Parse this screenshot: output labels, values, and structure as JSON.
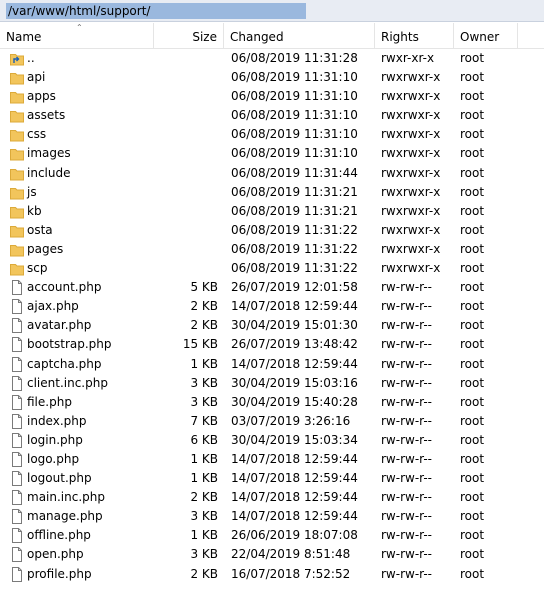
{
  "path": "/var/www/html/support/",
  "columns": {
    "name": "Name",
    "size": "Size",
    "changed": "Changed",
    "rights": "Rights",
    "owner": "Owner"
  },
  "colors": {
    "path_highlight": "#9ab8de",
    "folder": "#f2c55c",
    "folder_dark": "#dcaa3a",
    "file_border": "#7a7a7a"
  },
  "rows": [
    {
      "type": "parent",
      "name": "..",
      "size": "",
      "changed": "06/08/2019 11:31:28",
      "rights": "rwxr-xr-x",
      "owner": "root"
    },
    {
      "type": "folder",
      "name": "api",
      "size": "",
      "changed": "06/08/2019 11:31:10",
      "rights": "rwxrwxr-x",
      "owner": "root"
    },
    {
      "type": "folder",
      "name": "apps",
      "size": "",
      "changed": "06/08/2019 11:31:10",
      "rights": "rwxrwxr-x",
      "owner": "root"
    },
    {
      "type": "folder",
      "name": "assets",
      "size": "",
      "changed": "06/08/2019 11:31:10",
      "rights": "rwxrwxr-x",
      "owner": "root"
    },
    {
      "type": "folder",
      "name": "css",
      "size": "",
      "changed": "06/08/2019 11:31:10",
      "rights": "rwxrwxr-x",
      "owner": "root"
    },
    {
      "type": "folder",
      "name": "images",
      "size": "",
      "changed": "06/08/2019 11:31:10",
      "rights": "rwxrwxr-x",
      "owner": "root"
    },
    {
      "type": "folder",
      "name": "include",
      "size": "",
      "changed": "06/08/2019 11:31:44",
      "rights": "rwxrwxr-x",
      "owner": "root"
    },
    {
      "type": "folder",
      "name": "js",
      "size": "",
      "changed": "06/08/2019 11:31:21",
      "rights": "rwxrwxr-x",
      "owner": "root"
    },
    {
      "type": "folder",
      "name": "kb",
      "size": "",
      "changed": "06/08/2019 11:31:21",
      "rights": "rwxrwxr-x",
      "owner": "root"
    },
    {
      "type": "folder",
      "name": "osta",
      "size": "",
      "changed": "06/08/2019 11:31:22",
      "rights": "rwxrwxr-x",
      "owner": "root"
    },
    {
      "type": "folder",
      "name": "pages",
      "size": "",
      "changed": "06/08/2019 11:31:22",
      "rights": "rwxrwxr-x",
      "owner": "root"
    },
    {
      "type": "folder",
      "name": "scp",
      "size": "",
      "changed": "06/08/2019 11:31:22",
      "rights": "rwxrwxr-x",
      "owner": "root"
    },
    {
      "type": "file",
      "name": "account.php",
      "size": "5 KB",
      "changed": "26/07/2019 12:01:58",
      "rights": "rw-rw-r--",
      "owner": "root"
    },
    {
      "type": "file",
      "name": "ajax.php",
      "size": "2 KB",
      "changed": "14/07/2018 12:59:44",
      "rights": "rw-rw-r--",
      "owner": "root"
    },
    {
      "type": "file",
      "name": "avatar.php",
      "size": "2 KB",
      "changed": "30/04/2019 15:01:30",
      "rights": "rw-rw-r--",
      "owner": "root"
    },
    {
      "type": "file",
      "name": "bootstrap.php",
      "size": "15 KB",
      "changed": "26/07/2019 13:48:42",
      "rights": "rw-rw-r--",
      "owner": "root"
    },
    {
      "type": "file",
      "name": "captcha.php",
      "size": "1 KB",
      "changed": "14/07/2018 12:59:44",
      "rights": "rw-rw-r--",
      "owner": "root"
    },
    {
      "type": "file",
      "name": "client.inc.php",
      "size": "3 KB",
      "changed": "30/04/2019 15:03:16",
      "rights": "rw-rw-r--",
      "owner": "root"
    },
    {
      "type": "file",
      "name": "file.php",
      "size": "3 KB",
      "changed": "30/04/2019 15:40:28",
      "rights": "rw-rw-r--",
      "owner": "root"
    },
    {
      "type": "file",
      "name": "index.php",
      "size": "7 KB",
      "changed": "03/07/2019 3:26:16",
      "rights": "rw-rw-r--",
      "owner": "root"
    },
    {
      "type": "file",
      "name": "login.php",
      "size": "6 KB",
      "changed": "30/04/2019 15:03:34",
      "rights": "rw-rw-r--",
      "owner": "root"
    },
    {
      "type": "file",
      "name": "logo.php",
      "size": "1 KB",
      "changed": "14/07/2018 12:59:44",
      "rights": "rw-rw-r--",
      "owner": "root"
    },
    {
      "type": "file",
      "name": "logout.php",
      "size": "1 KB",
      "changed": "14/07/2018 12:59:44",
      "rights": "rw-rw-r--",
      "owner": "root"
    },
    {
      "type": "file",
      "name": "main.inc.php",
      "size": "2 KB",
      "changed": "14/07/2018 12:59:44",
      "rights": "rw-rw-r--",
      "owner": "root"
    },
    {
      "type": "file",
      "name": "manage.php",
      "size": "3 KB",
      "changed": "14/07/2018 12:59:44",
      "rights": "rw-rw-r--",
      "owner": "root"
    },
    {
      "type": "file",
      "name": "offline.php",
      "size": "1 KB",
      "changed": "26/06/2019 18:07:08",
      "rights": "rw-rw-r--",
      "owner": "root"
    },
    {
      "type": "file",
      "name": "open.php",
      "size": "3 KB",
      "changed": "22/04/2019 8:51:48",
      "rights": "rw-rw-r--",
      "owner": "root"
    },
    {
      "type": "file",
      "name": "profile.php",
      "size": "2 KB",
      "changed": "16/07/2018 7:52:52",
      "rights": "rw-rw-r--",
      "owner": "root"
    }
  ]
}
